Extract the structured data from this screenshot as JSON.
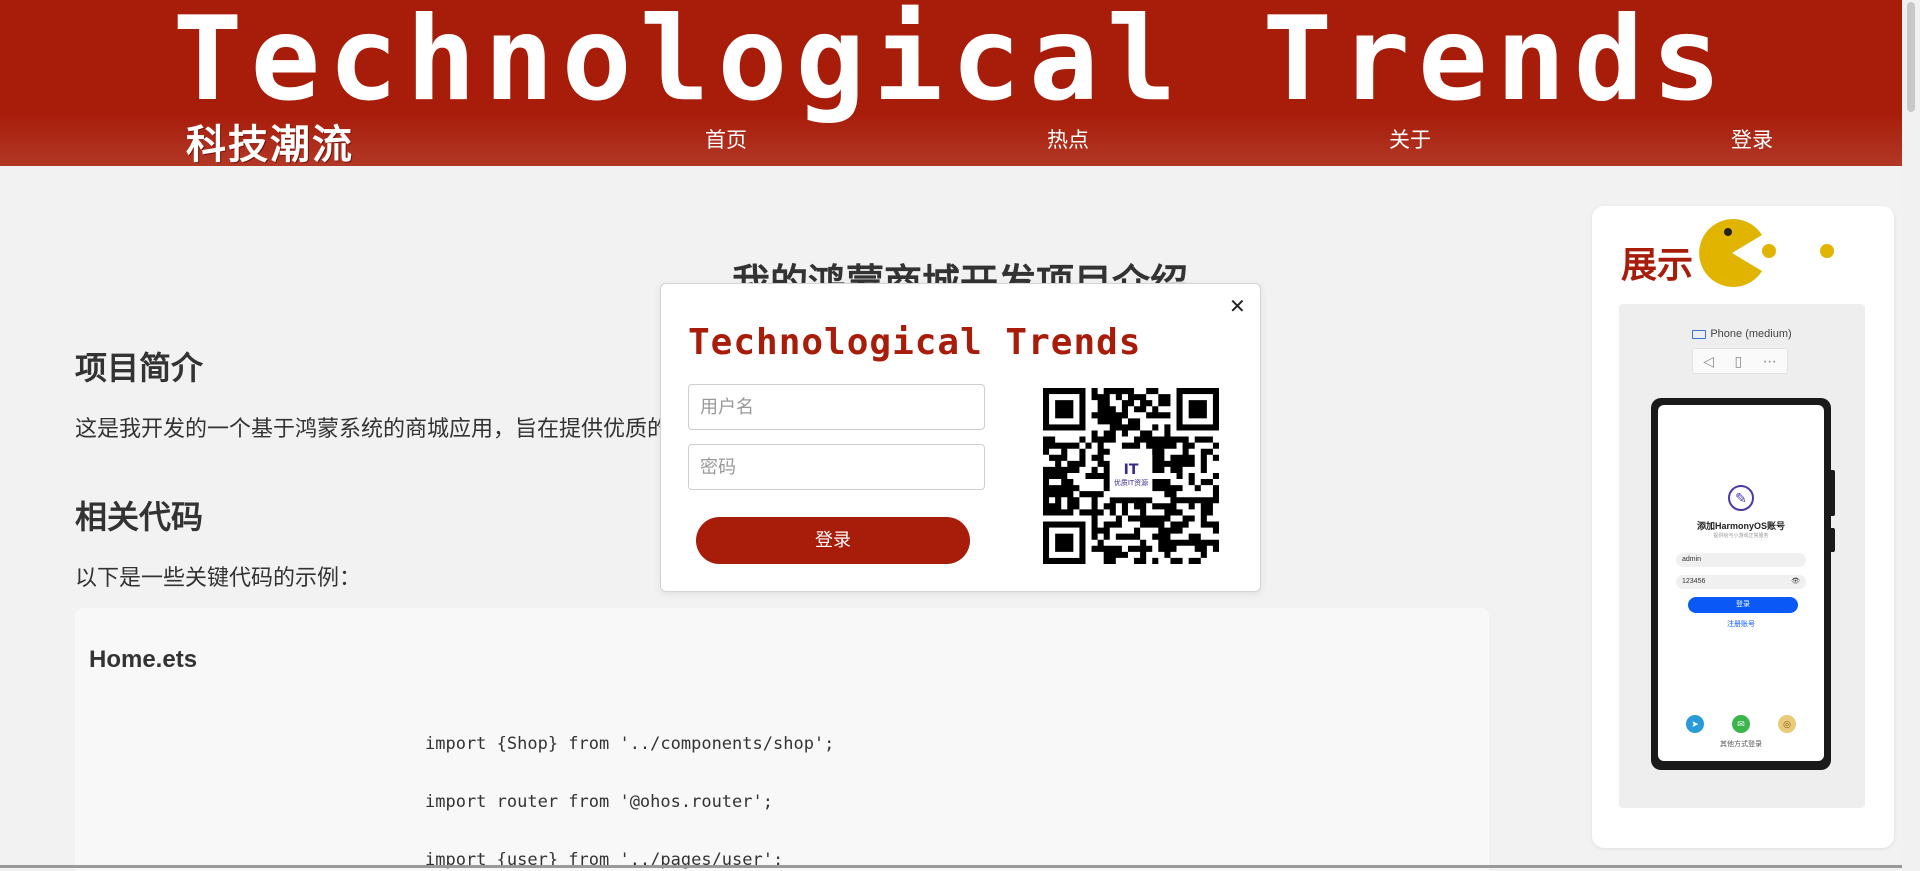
{
  "header": {
    "site_title": "Technological Trends",
    "brand_cn": "科技潮流",
    "nav": [
      "首页",
      "热点",
      "关于",
      "登录"
    ]
  },
  "main": {
    "heading": "我的鸿蒙商城开发项目介绍",
    "intro_title": "项目简介",
    "intro_text": "这是我开发的一个基于鸿蒙系统的商城应用，旨在提供优质的",
    "code_title": "相关代码",
    "code_intro": "以下是一些关键代码的示例：",
    "code_filename": "Home.ets",
    "code_lines": [
      "import {Shop} from '../components/shop';",
      "import router from '@ohos.router';",
      "import {user} from '../pages/user';"
    ]
  },
  "showcase": {
    "title": "展示",
    "simulator_label": "Phone (medium)",
    "phone": {
      "app_title": "添加HarmonyOS账号",
      "app_subtitle": "提供给与小游戏正常服务",
      "username": "admin",
      "password": "123456",
      "login_btn": "登录",
      "register_link": "注册账号",
      "other_login": "其他方式登录"
    }
  },
  "modal": {
    "title": "Technological Trends",
    "username_placeholder": "用户名",
    "password_placeholder": "密码",
    "login_label": "登录",
    "qr_badge": "优质IT资源"
  },
  "colors": {
    "brand": "#a81c0a",
    "accent_yellow": "#e1b400",
    "harmony_blue": "#0a59f7"
  }
}
